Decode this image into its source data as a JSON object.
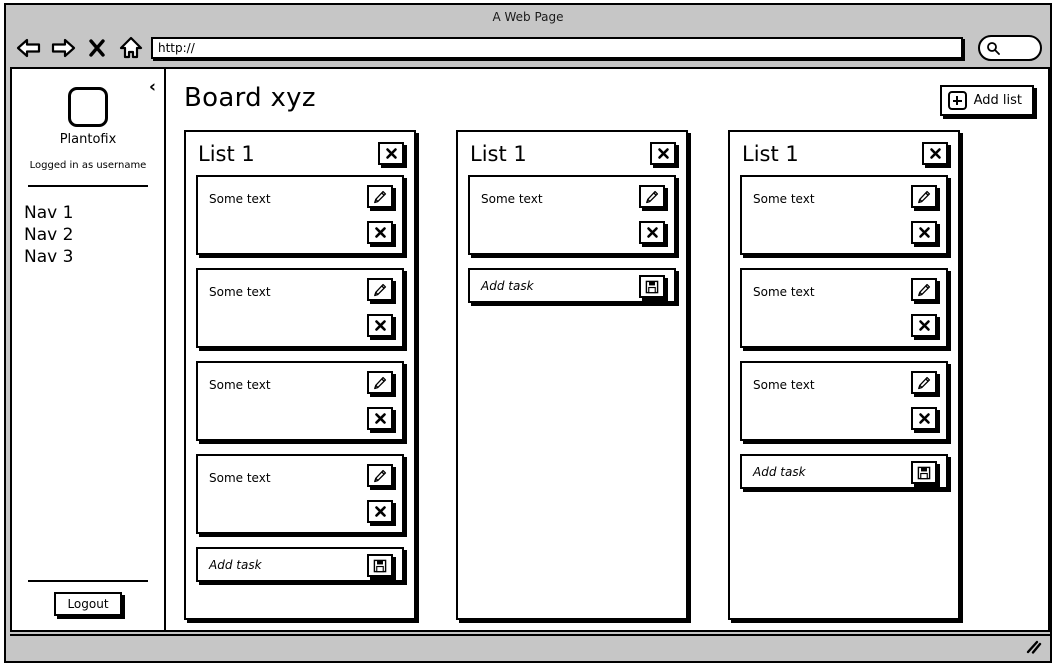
{
  "browser": {
    "window_title": "A Web Page",
    "url_value": "http://",
    "back_icon": "back-arrow-icon",
    "forward_icon": "forward-arrow-icon",
    "stop_icon": "stop-x-icon",
    "home_icon": "home-icon",
    "search_icon": "magnifier-icon",
    "resize_grip_icon": "resize-grip-icon"
  },
  "sidebar": {
    "collapse_chevron": "‹",
    "logo_icon": "app-logo-placeholder-icon",
    "brand": "Plantofix",
    "logged_in_text": "Logged in as username",
    "nav": [
      {
        "label": "Nav 1"
      },
      {
        "label": "Nav 2"
      },
      {
        "label": "Nav 3"
      }
    ],
    "logout_label": "Logout"
  },
  "board": {
    "title": "Board xyz",
    "add_list_label": "Add list",
    "add_list_icon": "plus-square-icon",
    "list_delete_icon": "close-x-icon",
    "card_edit_icon": "pencil-edit-icon",
    "card_delete_icon": "close-x-icon",
    "add_task_save_icon": "floppy-save-icon",
    "lists": [
      {
        "title": "List 1",
        "cards": [
          {
            "text": "Some text"
          },
          {
            "text": "Some text"
          },
          {
            "text": "Some text"
          },
          {
            "text": "Some text"
          }
        ],
        "add_task_placeholder": "Add task"
      },
      {
        "title": "List 1",
        "cards": [
          {
            "text": "Some text"
          }
        ],
        "add_task_placeholder": "Add task"
      },
      {
        "title": "List 1",
        "cards": [
          {
            "text": "Some text"
          },
          {
            "text": "Some text"
          },
          {
            "text": "Some text"
          }
        ],
        "add_task_placeholder": "Add task"
      }
    ]
  },
  "colors": {
    "chrome": "#c6c6c6",
    "ink": "#000000",
    "paper": "#ffffff"
  }
}
